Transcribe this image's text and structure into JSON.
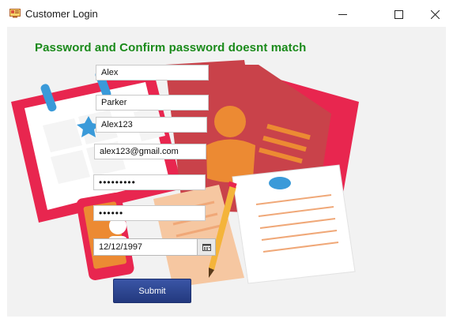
{
  "window": {
    "title": "Customer Login",
    "icon": "app-icon"
  },
  "status": {
    "message": "Password and Confirm password doesnt match",
    "color": "#1a8a1a"
  },
  "form": {
    "first_name": "Alex",
    "last_name": "Parker",
    "username": "Alex123",
    "email": "alex123@gmail.com",
    "password_masked": "•••••••••",
    "confirm_password_masked": "••••••",
    "dob": "12/12/1997"
  },
  "buttons": {
    "submit_label": "Submit"
  },
  "colors": {
    "background": "#f2f2f2",
    "submit": "#2b4590",
    "illustration_red": "#c9424a",
    "illustration_pink": "#e8264f"
  }
}
